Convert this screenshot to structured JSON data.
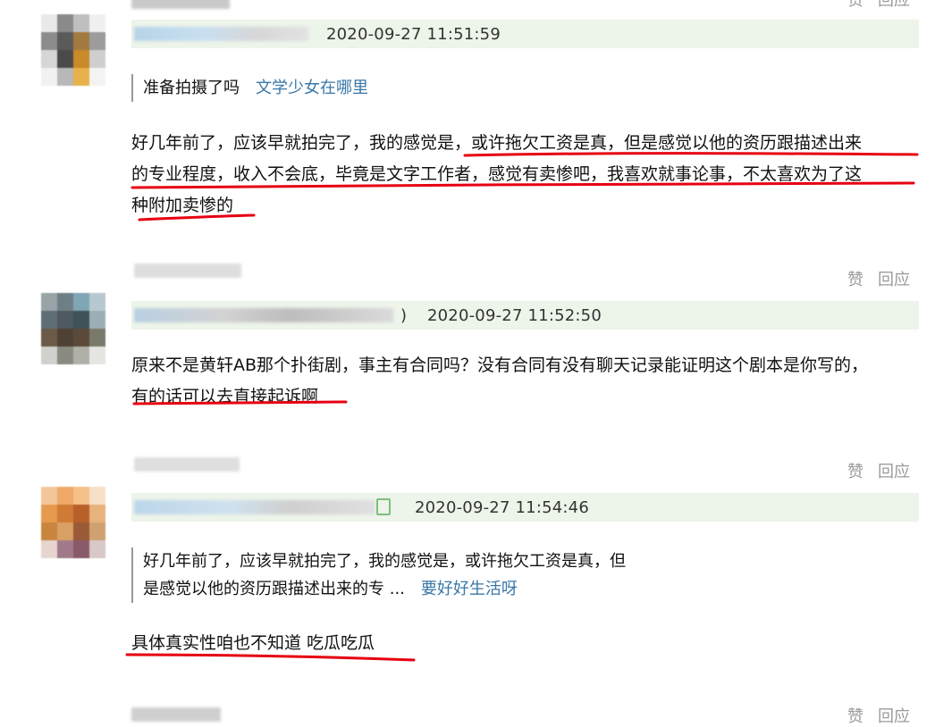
{
  "comments": [
    {
      "time": "2020-09-27 11:51:59",
      "quote": {
        "text": "准备拍摄了吗",
        "author": "文学少女在哪里"
      },
      "content_lines": [
        "好几年前了，应该早就拍完了，我的感觉是，或许拖欠工资是真，但是感觉以他的资历跟描述出来",
        "的专业程度，收入不会底，毕竟是文字工作者，感觉有卖惨吧，我喜欢就事论事，不太喜欢为了这",
        "种附加卖惨的"
      ]
    },
    {
      "actions": {
        "like": "赞",
        "reply": "回应"
      },
      "name_suffix": ")",
      "time": "2020-09-27 11:52:50",
      "content_lines": [
        "原来不是黄轩AB那个扑街剧，事主有合同吗？没有合同有没有聊天记录能证明这个剧本是你写的，",
        "有的话可以去直接起诉啊"
      ]
    },
    {
      "actions": {
        "like": "赞",
        "reply": "回应"
      },
      "time": "2020-09-27 11:54:46",
      "quote": {
        "line1": "好几年前了，应该早就拍完了，我的感觉是，或许拖欠工资是真，但",
        "line2": "是感觉以他的资历跟描述出来的专 ...",
        "author": "要好好生活呀"
      },
      "content_lines": [
        "具体真实性咱也不知道 吃瓜吃瓜"
      ]
    }
  ],
  "top_actions": {
    "like": "赞",
    "reply": "回应"
  },
  "bottom_actions": {
    "like": "赞",
    "reply": "回应"
  },
  "colors": {
    "meta_bar": "#edf4ea",
    "link": "#3877a8",
    "underline": "#e60012",
    "action": "#9a9a9a"
  }
}
